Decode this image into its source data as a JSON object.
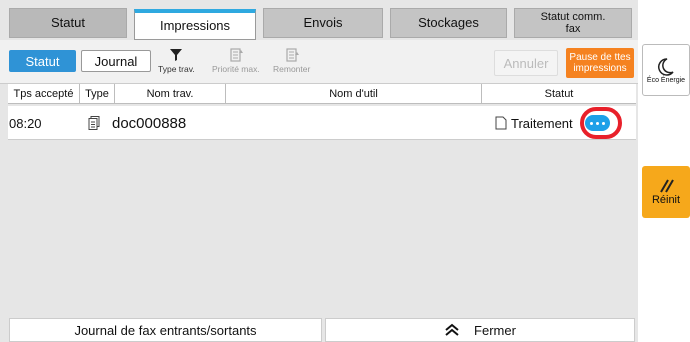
{
  "tabs": {
    "statut": "Statut",
    "impressions": "Impressions",
    "envois": "Envois",
    "stockages": "Stockages",
    "fax_line1": "Statut comm.",
    "fax_line2": "fax"
  },
  "toolbar": {
    "statut": "Statut",
    "journal": "Journal",
    "type_trav": "Type trav.",
    "priorite_max": "Priorité max.",
    "remonter": "Remonter",
    "annuler": "Annuler",
    "pause_line1": "Pause de ttes",
    "pause_line2": "impressions"
  },
  "table": {
    "headers": [
      "Tps accepté",
      "Type",
      "Nom trav.",
      "Nom d'util",
      "Statut"
    ],
    "rows": [
      {
        "tps": "08:20",
        "type_icon": "document-icon",
        "nom": "doc000888",
        "user": "",
        "statut": "Traitement"
      }
    ]
  },
  "bottom": {
    "journal_fax": "Journal de fax entrants/sortants",
    "fermer": "Fermer"
  },
  "side": {
    "eco": "Éco Énergie",
    "reinit": "Réinit"
  },
  "colors": {
    "accent": "#2fa9e0",
    "statut_button": "#2f93d6",
    "pause_button": "#f58220",
    "reinit_button": "#f6a81b",
    "highlight": "#e8202a"
  }
}
